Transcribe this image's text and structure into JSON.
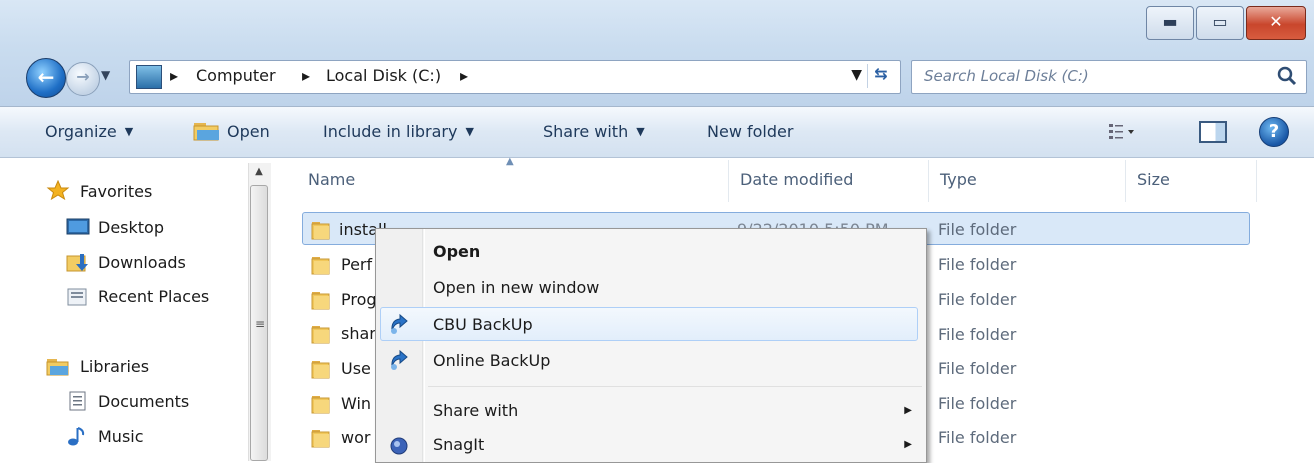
{
  "window": {
    "buttons": {
      "minimize": "▬",
      "maximize": "▭",
      "close": "✕"
    }
  },
  "address": {
    "crumbs": [
      "Computer",
      "Local Disk (C:)"
    ],
    "separator": "▸"
  },
  "search": {
    "placeholder": "Search Local Disk (C:)"
  },
  "toolbar": {
    "organize": "Organize",
    "open": "Open",
    "include": "Include in library",
    "share": "Share with",
    "new_folder": "New folder"
  },
  "nav": {
    "favorites": "Favorites",
    "desktop": "Desktop",
    "downloads": "Downloads",
    "recent": "Recent Places",
    "libraries": "Libraries",
    "documents": "Documents",
    "music": "Music"
  },
  "columns": {
    "name": "Name",
    "date": "Date modified",
    "type": "Type",
    "size": "Size"
  },
  "files": [
    {
      "name": "install",
      "date": "9/22/2010 5:50 PM",
      "type": "File folder"
    },
    {
      "name": "Perf",
      "date": "",
      "type": "File folder"
    },
    {
      "name": "Prog",
      "date": "",
      "type": "File folder"
    },
    {
      "name": "shar",
      "date": "",
      "type": "File folder"
    },
    {
      "name": "Use",
      "date": "",
      "type": "File folder"
    },
    {
      "name": "Win",
      "date": "",
      "type": "File folder"
    },
    {
      "name": "wor",
      "date": "",
      "type": "File folder"
    }
  ],
  "context_menu": {
    "open": "Open",
    "open_new": "Open in new window",
    "cbu": "CBU BackUp",
    "online": "Online BackUp",
    "share": "Share with",
    "snagit": "SnagIt",
    "arrow": "▶"
  },
  "colors": {
    "accent": "#1e395b",
    "selection": "#d9e8f8",
    "close": "#c9462c"
  }
}
